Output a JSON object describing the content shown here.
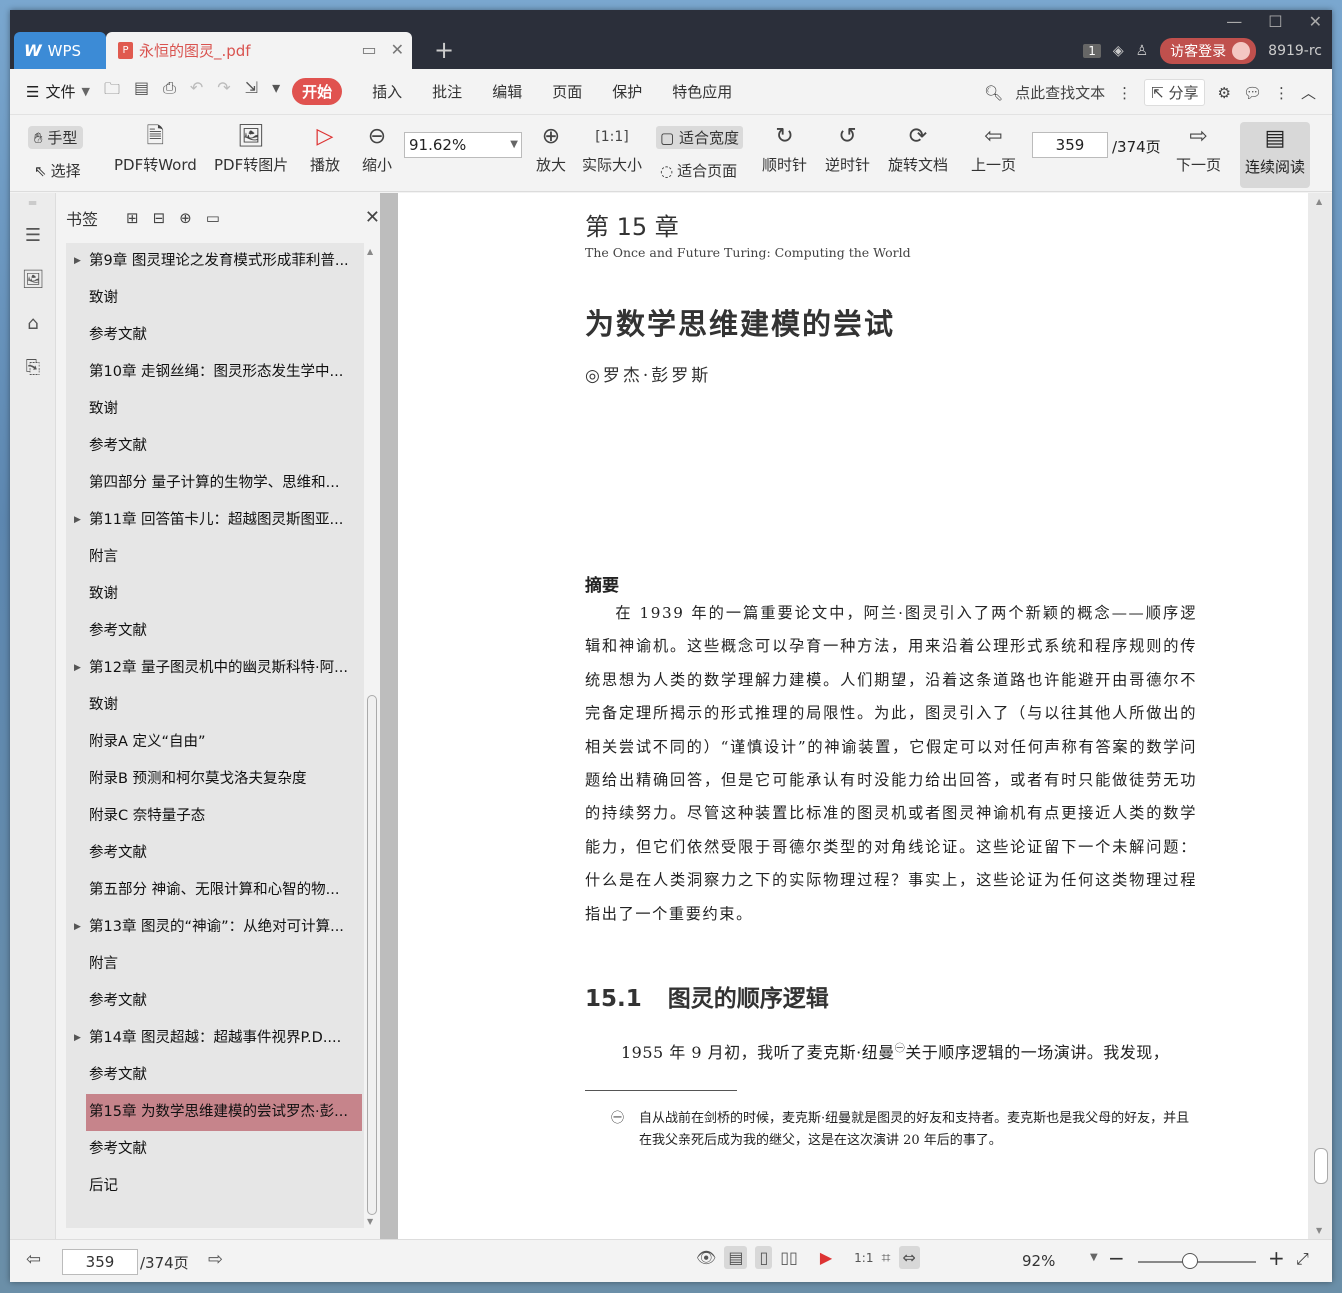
{
  "titlebar": {
    "wps_tab": "WPS",
    "doc_tab": "永恒的图灵_.pdf",
    "page_badge": "1",
    "login": "访客登录",
    "version": "8919-rc"
  },
  "menubar": {
    "file": "文件",
    "start": "开始",
    "insert": "插入",
    "annotate": "批注",
    "edit": "编辑",
    "page": "页面",
    "protect": "保护",
    "special": "特色应用",
    "search": "点此查找文本",
    "share": "分享"
  },
  "toolbar": {
    "hand": "手型",
    "select": "选择",
    "pdf_to_word": "PDF转Word",
    "pdf_to_image": "PDF转图片",
    "play": "播放",
    "zoom_out": "缩小",
    "zoom_value": "91.62%",
    "zoom_in": "放大",
    "actual_size": "实际大小",
    "fit_width": "适合宽度",
    "fit_page": "适合页面",
    "clockwise": "顺时针",
    "counterclockwise": "逆时针",
    "rotate_doc": "旋转文档",
    "prev_page": "上一页",
    "page_number": "359",
    "page_total": "/374页",
    "next_page": "下一页",
    "continuous": "连续阅读"
  },
  "bookmarks": {
    "title": "书签",
    "items": [
      {
        "label": "第9章 图灵理论之发育模式形成菲利普...",
        "expandable": true
      },
      {
        "label": "致谢",
        "expandable": false
      },
      {
        "label": "参考文献",
        "expandable": false
      },
      {
        "label": "第10章 走钢丝绳：图灵形态发生学中...",
        "expandable": false
      },
      {
        "label": "致谢",
        "expandable": false
      },
      {
        "label": "参考文献",
        "expandable": false
      },
      {
        "label": "第四部分 量子计算的生物学、思维和...",
        "expandable": false
      },
      {
        "label": "第11章 回答笛卡儿：超越图灵斯图亚...",
        "expandable": true
      },
      {
        "label": "附言",
        "expandable": false
      },
      {
        "label": "致谢",
        "expandable": false
      },
      {
        "label": "参考文献",
        "expandable": false
      },
      {
        "label": "第12章 量子图灵机中的幽灵斯科特·阿...",
        "expandable": true
      },
      {
        "label": "致谢",
        "expandable": false
      },
      {
        "label": "附录A 定义“自由”",
        "expandable": false
      },
      {
        "label": "附录B 预测和柯尔莫戈洛夫复杂度",
        "expandable": false
      },
      {
        "label": "附录C 奈特量子态",
        "expandable": false
      },
      {
        "label": "参考文献",
        "expandable": false
      },
      {
        "label": "第五部分 神谕、无限计算和心智的物...",
        "expandable": false
      },
      {
        "label": "第13章 图灵的“神谕”：从绝对可计算...",
        "expandable": true
      },
      {
        "label": "附言",
        "expandable": false
      },
      {
        "label": "参考文献",
        "expandable": false
      },
      {
        "label": "第14章 图灵超越：超越事件视界P.D....",
        "expandable": true
      },
      {
        "label": "参考文献",
        "expandable": false
      },
      {
        "label": "第15章 为数学思维建模的尝试罗杰·彭...",
        "expandable": true,
        "active": true
      },
      {
        "label": "参考文献",
        "expandable": false
      },
      {
        "label": "后记",
        "expandable": false
      }
    ]
  },
  "document": {
    "chapter": "第 15 章",
    "subtitle_en": "The Once and Future Turing: Computing the World",
    "title": "为数学思维建模的尝试",
    "author": "◎罗杰·彭罗斯",
    "abstract_heading": "摘要",
    "abstract": "在 1939 年的一篇重要论文中，阿兰·图灵引入了两个新颖的概念——顺序逻辑和神谕机。这些概念可以孕育一种方法，用来沿着公理形式系统和程序规则的传统思想为人类的数学理解力建模。人们期望，沿着这条道路也许能避开由哥德尔不完备定理所揭示的形式推理的局限性。为此，图灵引入了（与以往其他人所做出的相关尝试不同的）“谨慎设计”的神谕装置，它假定可以对任何声称有答案的数学问题给出精确回答，但是它可能承认有时没能力给出回答，或者有时只能做徒劳无功的持续努力。尽管这种装置比标准的图灵机或者图灵神谕机有点更接近人类的数学能力，但它们依然受限于哥德尔类型的对角线论证。这些论证留下一个未解问题：什么是在人类洞察力之下的实际物理过程？事实上，这些论证为任何这类物理过程指出了一个重要约束。",
    "section_num": "15.1",
    "section_title": "图灵的顺序逻辑",
    "body_line": "1955 年 9 月初，我听了麦克斯·纽曼",
    "footnote_mark": "㊀",
    "body_line_rest": "关于顺序逻辑的一场演讲。我发现，",
    "footnote": "自从战前在剑桥的时候，麦克斯·纽曼就是图灵的好友和支持者。麦克斯也是我父母的好友，并且在我父亲死后成为我的继父，这是在这次演讲 20 年后的事了。"
  },
  "statusbar": {
    "page_number": "359",
    "page_total": "/374页",
    "zoom": "92%"
  }
}
